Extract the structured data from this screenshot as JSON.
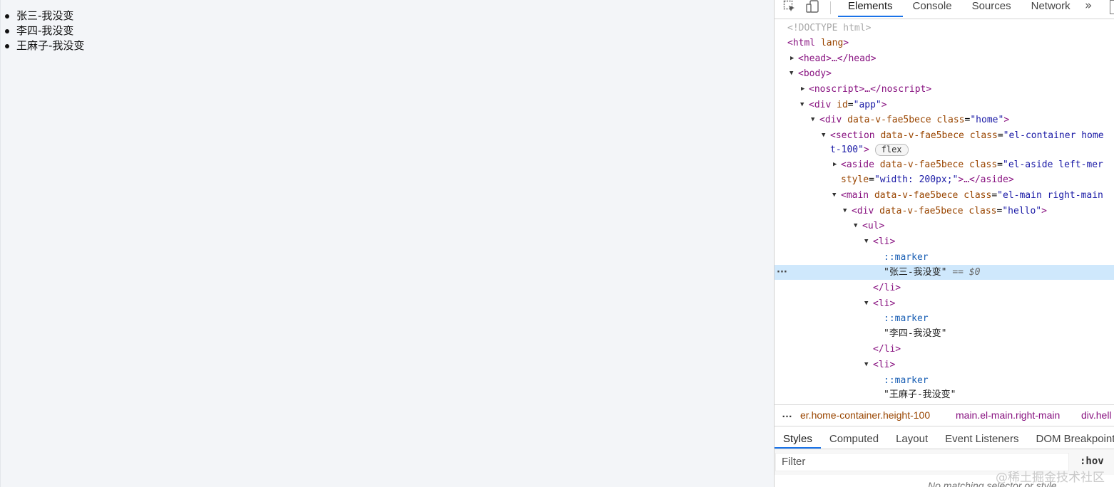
{
  "page": {
    "items": [
      "张三-我没变",
      "李四-我没变",
      "王麻子-我没变"
    ]
  },
  "devtools": {
    "tabs": [
      "Elements",
      "Console",
      "Sources",
      "Network"
    ],
    "more_tabs": "»",
    "dom_tree": {
      "doctype": "<!DOCTYPE html>",
      "html_open": "<html",
      "html_attr": "lang",
      "head": "<head>…</head>",
      "body": "<body>",
      "noscript": "<noscript>…</noscript>",
      "div_app_tag": "<div",
      "div_app_attr": "id",
      "div_app_val": "\"app\"",
      "div_home_tag": "<div",
      "data_v_attr": "data-v-fae5bece",
      "class_attr": "class",
      "div_home_val": "\"home\"",
      "section_tag": "<section",
      "section_val1": "\"el-container home",
      "section_val2": "t-100\"",
      "flex_badge": "flex",
      "aside_tag": "<aside",
      "aside_val": "\"el-aside left-mer",
      "style_attr": "style",
      "aside_style_val": "\"width: 200px;\"",
      "aside_close": ">…</aside>",
      "main_tag": "<main",
      "main_val": "\"el-main right-main",
      "div_hello_tag": "<div",
      "div_hello_val": "\"hello\"",
      "ul": "<ul>",
      "li_open": "<li>",
      "li_close": "</li>",
      "marker": "::marker",
      "text1": "\"张三-我没变\"",
      "eq0": "== $0",
      "text2": "\"李四-我没变\"",
      "text3": "\"王麻子-我没变\""
    },
    "breadcrumbs": [
      "er.home-container.height-100",
      "main.el-main.right-main",
      "div.hell"
    ],
    "subtabs": [
      "Styles",
      "Computed",
      "Layout",
      "Event Listeners",
      "DOM Breakpoints"
    ],
    "filter_placeholder": "Filter",
    "hov": ":hov",
    "no_matching": "No matching selector or style",
    "watermark": "@稀土掘金技术社区"
  }
}
